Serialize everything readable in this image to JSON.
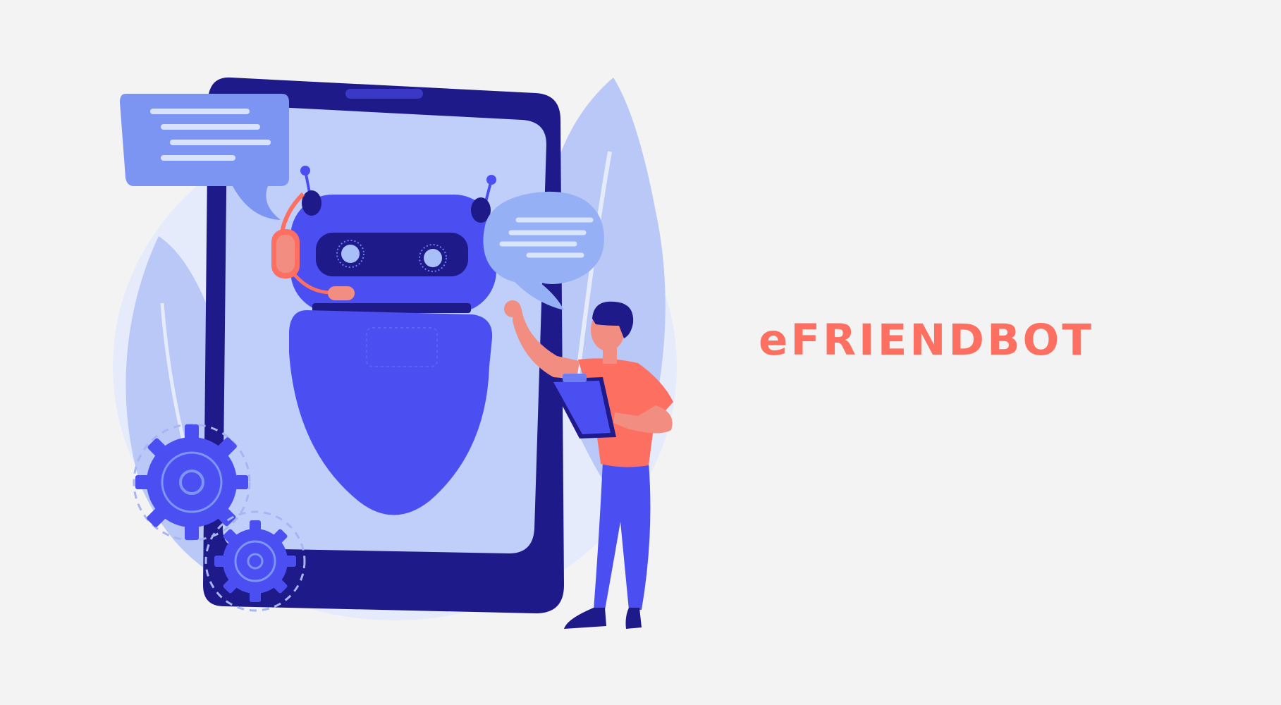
{
  "brand": {
    "title": "eFRIENDBOT"
  },
  "colors": {
    "background": "#f3f3f3",
    "accent": "#fd6f61",
    "tablet_frame": "#1f1a8a",
    "tablet_screen": "#c0cffa",
    "robot_body": "#4b4ff2",
    "speech_bubble": "#7d95f2",
    "leaf": "#b9c8f7"
  },
  "illustration": {
    "subjects": [
      "tablet",
      "chatbot-robot",
      "headset",
      "speech-bubble",
      "person-with-clipboard",
      "gears",
      "leaves"
    ]
  }
}
